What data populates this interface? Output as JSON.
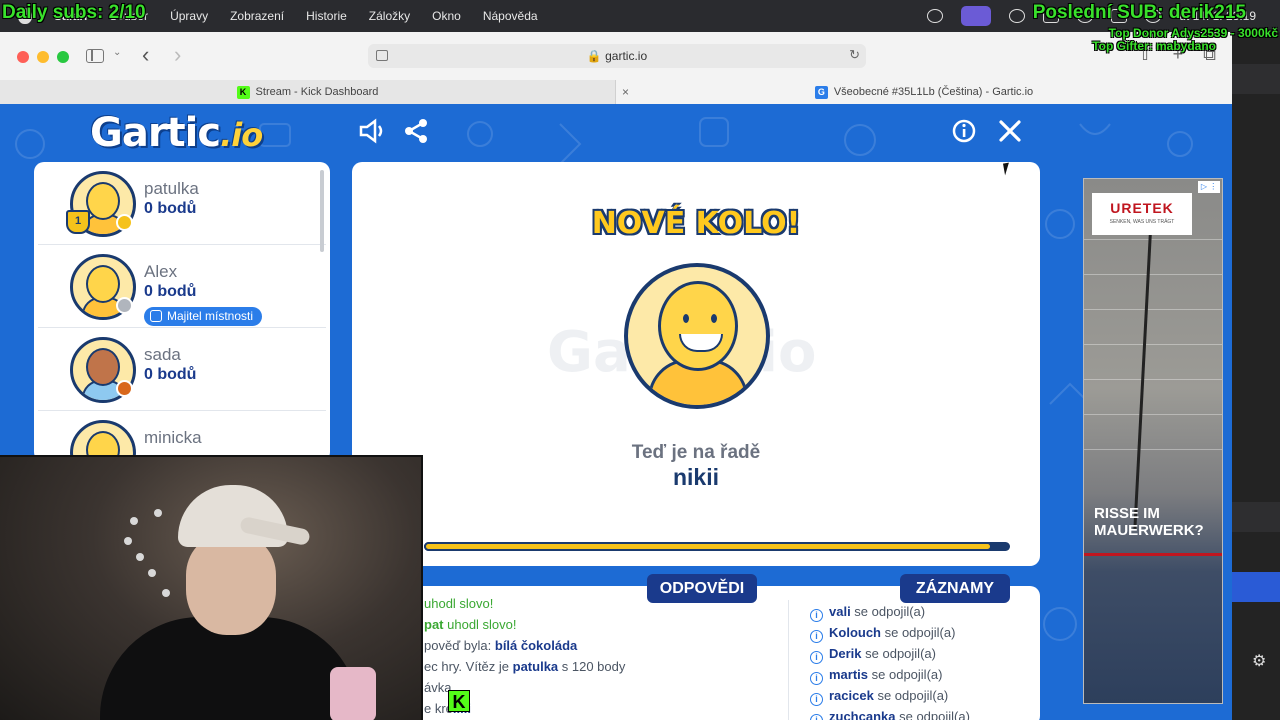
{
  "overlay": {
    "daily_subs": "Daily subs: 2/10",
    "last_sub": "Poslední SUB: derik215",
    "top_donor": "Top Donor Adys2539 - 3000kč",
    "top_gifter": "Top Gifter: mabydano"
  },
  "menubar": {
    "items": [
      "Safari",
      "Soubor",
      "Úpravy",
      "Zobrazení",
      "Historie",
      "Záložky",
      "Okno",
      "Nápověda"
    ],
    "clock": "út 14. 1. 23:19"
  },
  "browser": {
    "url": "gartic.io",
    "tabs": [
      {
        "title": "Stream - Kick Dashboard",
        "favicon": "K"
      },
      {
        "title": "Všeobecné #35L1Lb (Čeština) - Gartic.io",
        "favicon": "G"
      }
    ],
    "tab_close": "×"
  },
  "gartic": {
    "logo_main": "Gartic",
    "logo_suffix": ".io",
    "players": [
      {
        "name": "patulka",
        "score": "0 bodů",
        "rank": "1",
        "status_color": "#f5c21b",
        "skin": "light",
        "shirt": "yellow"
      },
      {
        "name": "Alex",
        "score": "0 bodů",
        "badge": "Majitel místnosti",
        "status_color": "#b0b5bd",
        "skin": "light",
        "shirt": "yellow"
      },
      {
        "name": "sada",
        "score": "0 bodů",
        "status_color": "#d9681c",
        "skin": "dark",
        "shirt": "blue"
      },
      {
        "name": "minicka",
        "score": "",
        "status_color": "#f5c21b",
        "skin": "light",
        "shirt": "yellow"
      }
    ],
    "canvas": {
      "watermark": "Gartic.io",
      "round_title": "NOVÉ KOLO!",
      "turn_label": "Teď je na řadě",
      "turn_player": "nikii",
      "progress_fraction": 0.97
    },
    "tabs": {
      "answers": "ODPOVĚDI",
      "records": "ZÁZNAMY"
    },
    "answers": [
      {
        "prefix": "",
        "name": "",
        "text": "uhodl slovo!"
      },
      {
        "prefix": "",
        "name": "pat",
        "text": "uhodl slovo!"
      },
      {
        "prefix": "pověď byla: ",
        "name": "bílá čokoláda",
        "text": ""
      },
      {
        "prefix": "ec hry. Vítěz je ",
        "name": "patulka",
        "text": " s 120 body"
      },
      {
        "prefix": "ávka.",
        "name": "",
        "text": ""
      },
      {
        "prefix": "e kre",
        "name": "l...i",
        "text": ""
      }
    ],
    "records": [
      {
        "name": "vali",
        "text": " se odpojil(a)"
      },
      {
        "name": "Kolouch",
        "text": " se odpojil(a)"
      },
      {
        "name": "Derik",
        "text": " se odpojil(a)"
      },
      {
        "name": "martis",
        "text": " se odpojil(a)"
      },
      {
        "name": "racicek",
        "text": " se odpojil(a)"
      },
      {
        "name": "zuchcanka",
        "text": " se odpojil(a)"
      }
    ]
  },
  "ad": {
    "brand": "URETEK",
    "tagline": "SENKEN, WAS UNS TRÄGT",
    "headline_1": "RISSE IM",
    "headline_2": "MAUERWERK?",
    "choice": "▷ ⋮"
  },
  "colors": {
    "gartic_blue": "#1d6bd4",
    "navy": "#1a3a8c",
    "yellow": "#ffc91e"
  }
}
